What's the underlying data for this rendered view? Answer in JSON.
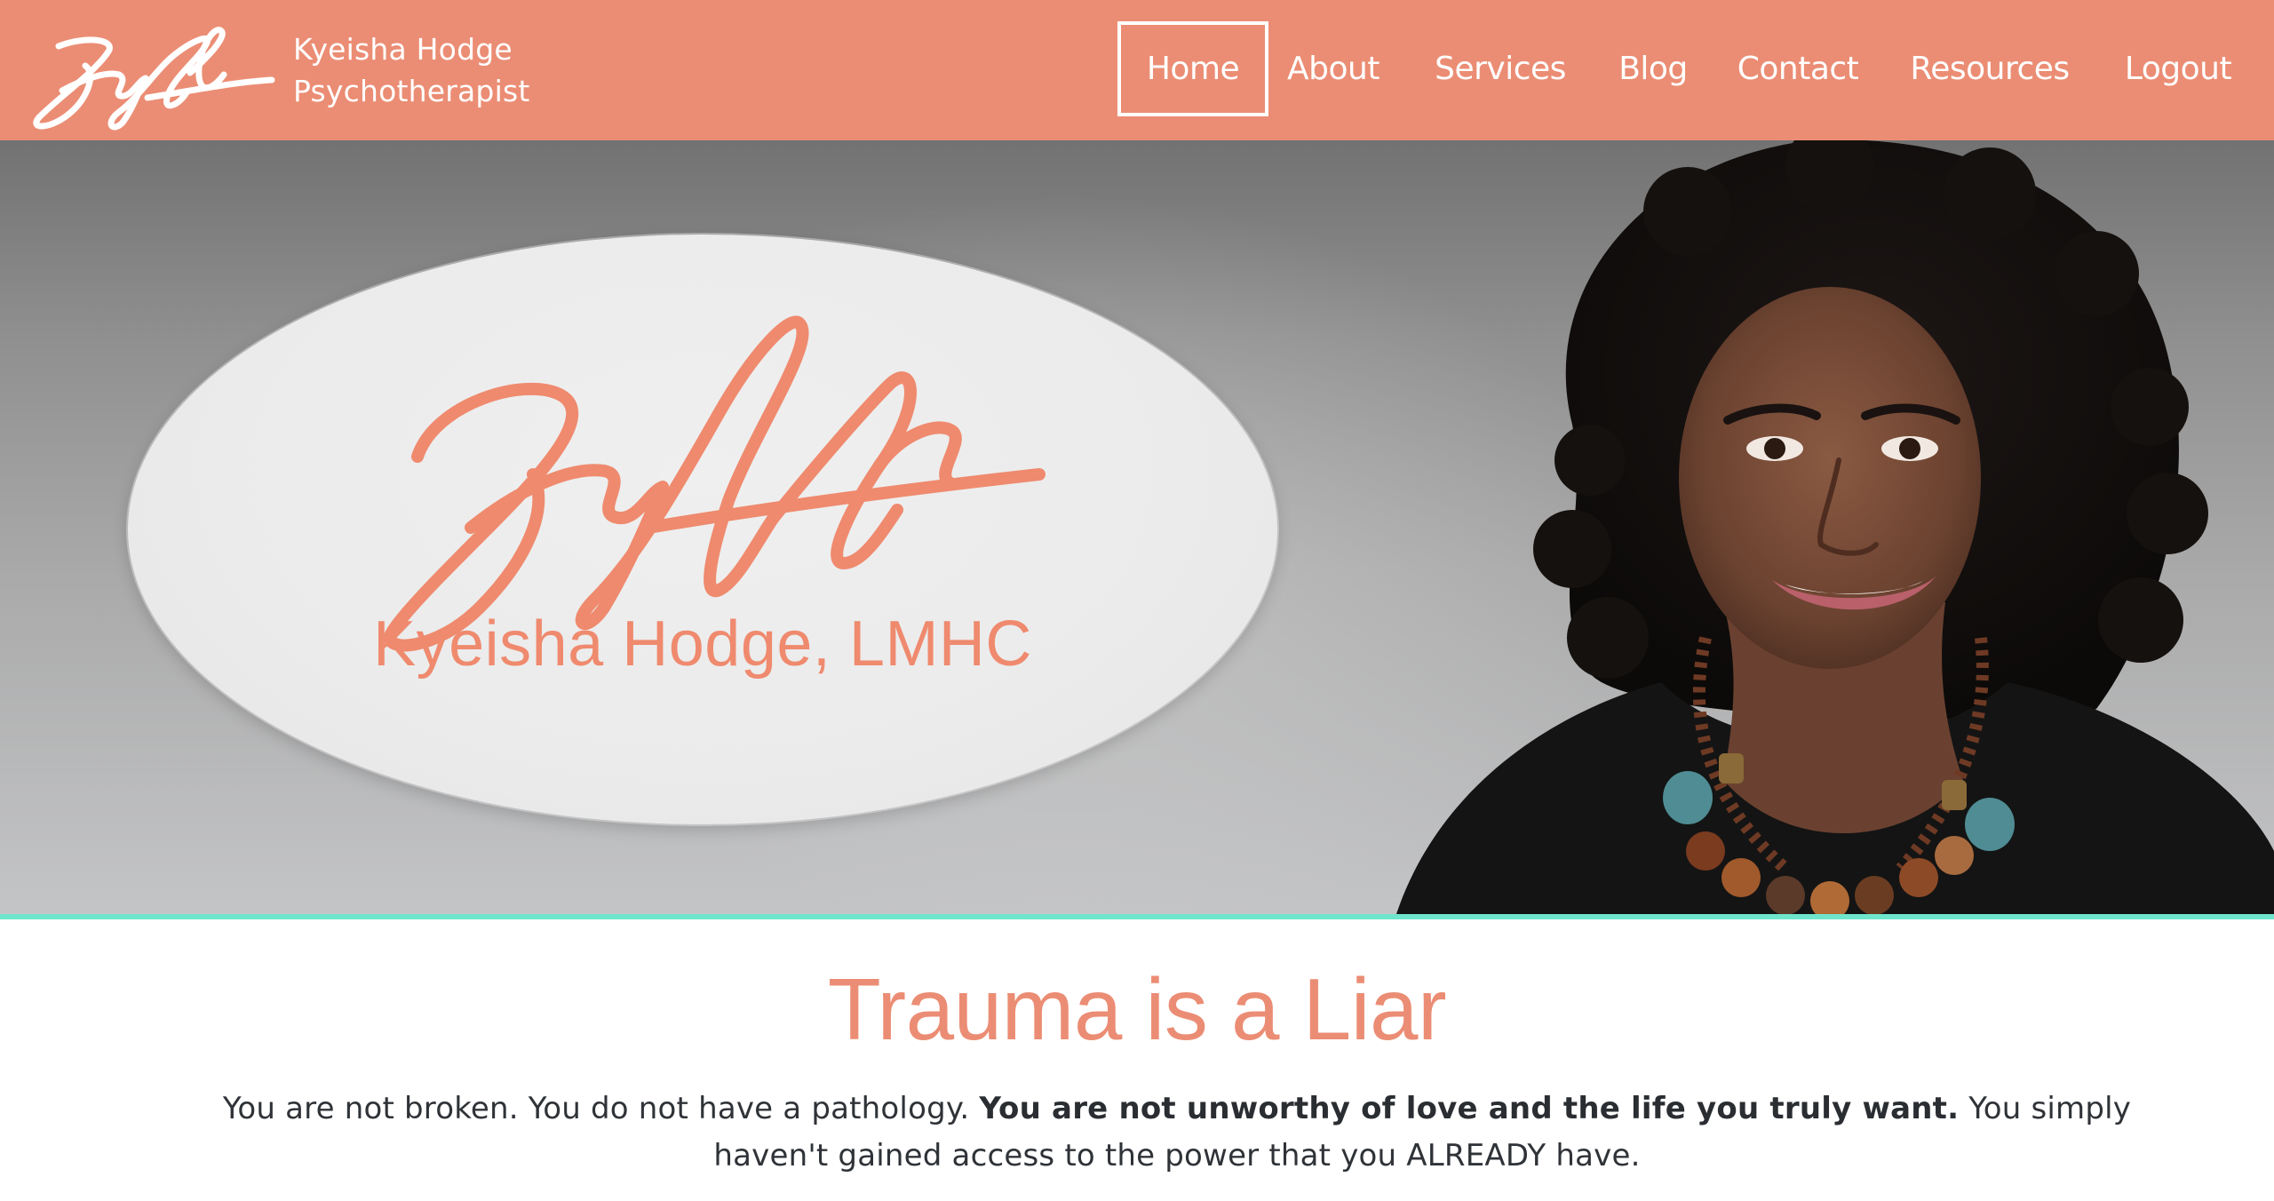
{
  "brand": {
    "logo_icon": "signature-logo",
    "name_line1": "Kyeisha Hodge",
    "name_line2": "Psychotherapist"
  },
  "nav": {
    "items": [
      {
        "label": "Home",
        "active": true
      },
      {
        "label": "About",
        "active": false
      },
      {
        "label": "Services",
        "active": false
      },
      {
        "label": "Blog",
        "active": false
      },
      {
        "label": "Contact",
        "active": false
      },
      {
        "label": "Resources",
        "active": false
      },
      {
        "label": "Logout",
        "active": false
      }
    ]
  },
  "hero": {
    "signature_icon": "signature-logo",
    "oval_caption": "Kyeisha Hodge, LMHC",
    "portrait_icon": "portrait-photo"
  },
  "main": {
    "headline": "Trauma is a Liar",
    "intro_part1": "You are not broken. You do not have a pathology. ",
    "intro_bold": "You are not unworthy of love and the life you truly want.",
    "intro_part2": " You simply haven't gained access to the power that you ALREADY have."
  },
  "colors": {
    "brand": "#eb8d74",
    "accent_line": "#6fe6cc",
    "signature": "#ef8a6e",
    "text": "#2f3338"
  }
}
